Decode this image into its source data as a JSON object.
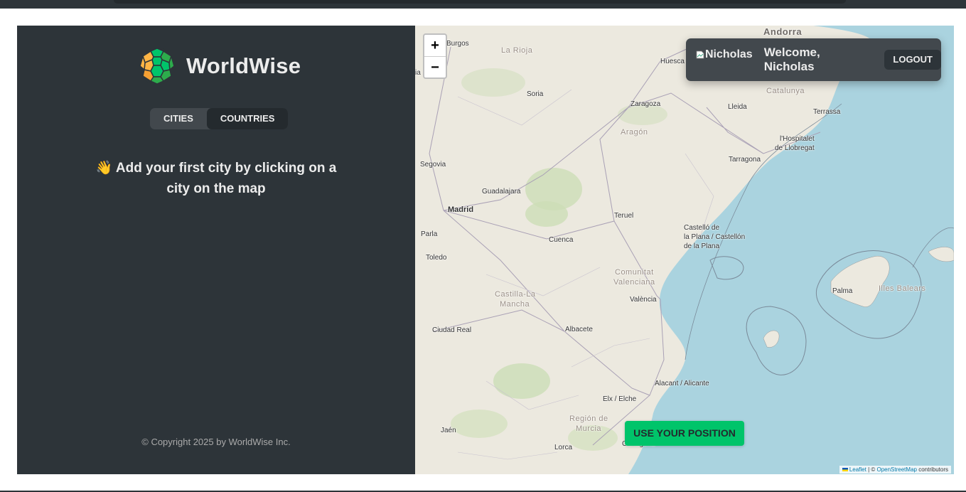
{
  "app": {
    "name": "WorldWise"
  },
  "sidebar": {
    "tabs": [
      {
        "label": "CITIES",
        "active": false
      },
      {
        "label": "COUNTRIES",
        "active": true
      }
    ],
    "message": "👋 Add your first city by clicking on a city on the map",
    "footer": "© Copyright 2025 by WorldWise Inc."
  },
  "map": {
    "zoom_in_label": "+",
    "zoom_out_label": "−",
    "user": {
      "avatar_alt": "Nicholas",
      "welcome": "Welcome, Nicholas",
      "logout_label": "LOGOUT"
    },
    "use_position_label": "USE YOUR POSITION",
    "attribution": {
      "leaflet": "Leaflet",
      "separator": " | © ",
      "osm": "OpenStreetMap",
      "suffix": " contributors"
    },
    "places": {
      "andorra": "Andorra",
      "burgos": "Burgos",
      "la_rioja": "La Rioja",
      "huesca": "Huesca",
      "soria": "Soria",
      "zaragoza": "Zaragoza",
      "lleida": "Lleida",
      "terrassa": "Terrassa",
      "catalunya": "Catalunya",
      "aragon": "Aragón",
      "hospitalet_1": "l'Hospitalet",
      "hospitalet_2": "de Llobregat",
      "tarragona": "Tarragona",
      "segovia": "Segovia",
      "guadalajara": "Guadalajara",
      "madrid": "Madrid",
      "teruel": "Teruel",
      "parla": "Parla",
      "cuenca": "Cuenca",
      "castello_1": "Castelló de",
      "castello_2": "la Plana / Castellón",
      "castello_3": "de la Plana",
      "toledo": "Toledo",
      "comunitat_1": "Comunitat",
      "comunitat_2": "Valenciana",
      "castilla_1": "Castilla-La",
      "castilla_2": "Mancha",
      "valencia": "València",
      "palma": "Palma",
      "illes_balears": "Illes Balears",
      "ciudad_real": "Ciudad Real",
      "albacete": "Albacete",
      "alacant": "Alacant / Alicante",
      "elx": "Elx / Elche",
      "region_murcia_1": "Región de",
      "region_murcia_2": "Murcia",
      "jaen": "Jaén",
      "lorca": "Lorca",
      "cartagena": "Cartagena",
      "ia": "ia"
    }
  },
  "colors": {
    "sidebar_bg": "#2d3439",
    "accent_green": "#00c46a",
    "sea": "#aad3df",
    "land": "#ece9df"
  }
}
